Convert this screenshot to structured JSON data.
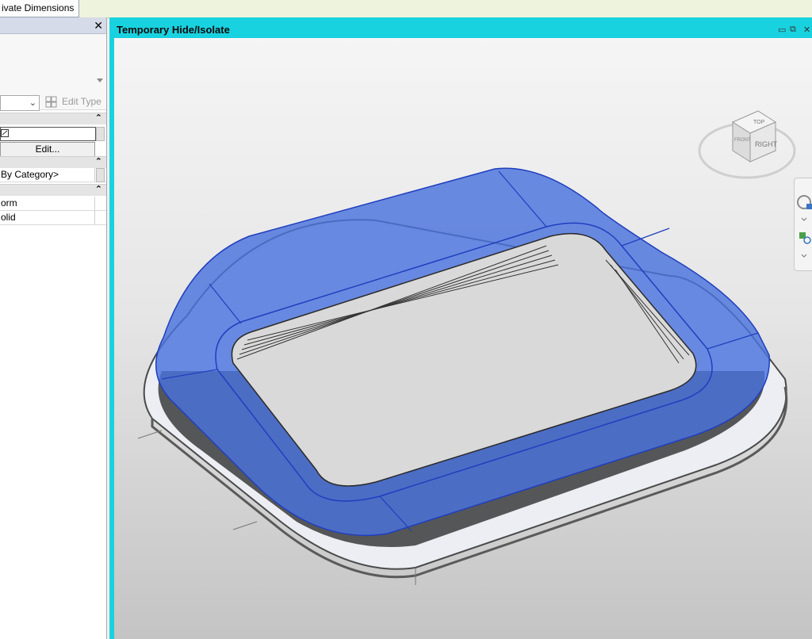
{
  "ribbon": {
    "tab_label": "ivate Dimensions"
  },
  "properties": {
    "close_glyph": "✕",
    "filter_chevron": "⌄",
    "edit_type_label": "Edit Type",
    "collapse_glyph": "⌃",
    "edit_button_label": "Edit...",
    "visibility_value": "By Category>",
    "rows": [
      {
        "value": "orm"
      },
      {
        "value": "olid"
      }
    ]
  },
  "view": {
    "label": "Temporary Hide/Isolate",
    "controls": {
      "minimize": "▭",
      "restore": "⧉",
      "close": "✕"
    },
    "viewcube_faces": {
      "top": "TOP",
      "right": "RIGHT",
      "front": "FRONT"
    }
  },
  "colors": {
    "view_border": "#19d2df",
    "form_blue": "#4a73dd",
    "form_edge": "#1f3fbf",
    "base_plate": "#eceef3"
  }
}
